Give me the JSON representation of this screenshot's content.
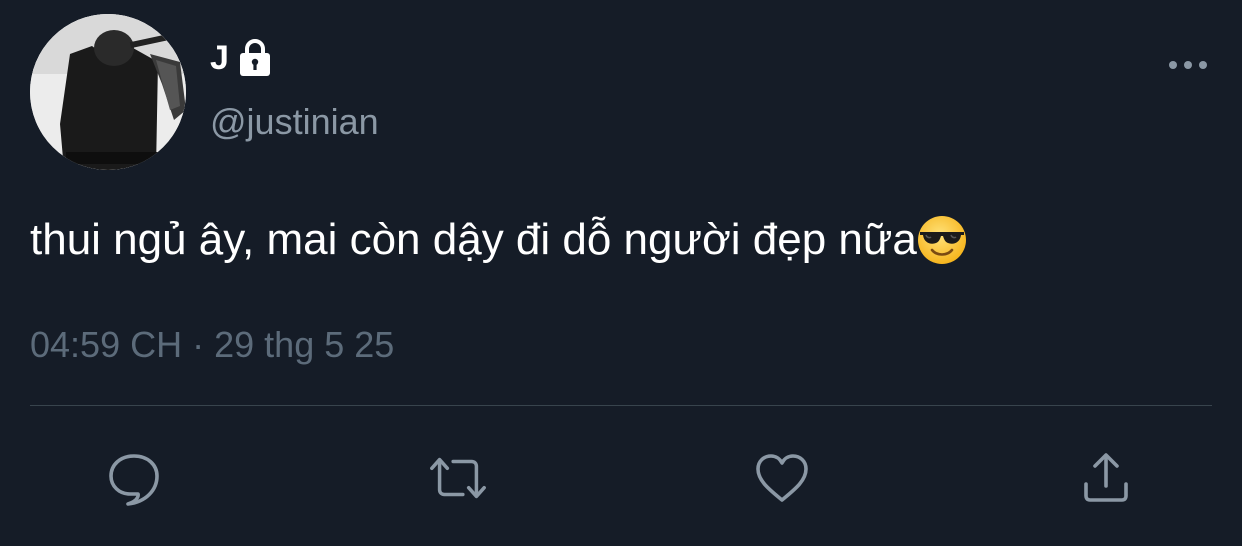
{
  "user": {
    "display_name": "J",
    "handle": "@justinian",
    "protected_icon": "lock-icon",
    "avatar": "user-avatar"
  },
  "tweet": {
    "text": "thui ngủ ây, mai còn dậy đi dỗ người đẹp nữa",
    "emoji": "smiling-face-with-sunglasses",
    "timestamp": "04:59 CH",
    "separator": "·",
    "date": "29 thg 5 25"
  },
  "actions": [
    {
      "name": "reply",
      "icon": "comment-icon"
    },
    {
      "name": "retweet",
      "icon": "retweet-icon"
    },
    {
      "name": "like",
      "icon": "heart-icon"
    },
    {
      "name": "share",
      "icon": "share-icon"
    }
  ],
  "colors": {
    "background": "#151c27",
    "text": "#ffffff",
    "secondary_text": "#8b98a5",
    "meta_text": "#5c6b7a",
    "icon": "#8b98a5",
    "divider": "#38444d"
  }
}
